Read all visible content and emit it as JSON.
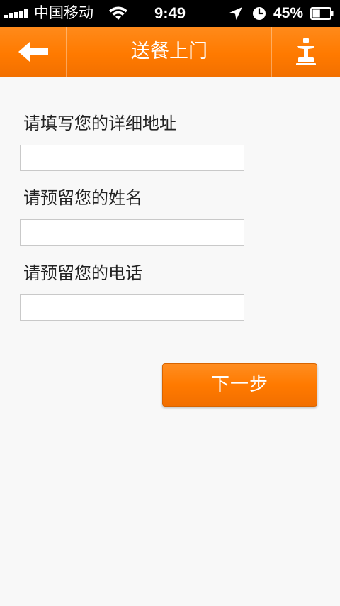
{
  "status_bar": {
    "carrier": "中国移动",
    "time": "9:49",
    "battery_percent": "45%",
    "battery_level": 0.45,
    "icons": [
      "signal-icon",
      "wifi-icon",
      "location-icon",
      "clock-icon",
      "battery-icon"
    ]
  },
  "nav": {
    "title": "送餐上门",
    "back_icon": "back-arrow-icon",
    "right_icon": "chef-icon",
    "colors": {
      "bar": "#ff7a00",
      "text": "#ffffff"
    }
  },
  "form": {
    "address": {
      "label": "请填写您的详细地址",
      "value": "",
      "placeholder": ""
    },
    "name": {
      "label": "请预留您的姓名",
      "value": "",
      "placeholder": ""
    },
    "phone": {
      "label": "请预留您的电话",
      "value": "",
      "placeholder": ""
    }
  },
  "actions": {
    "next_label": "下一步",
    "accent_color": "#ff7a00"
  }
}
